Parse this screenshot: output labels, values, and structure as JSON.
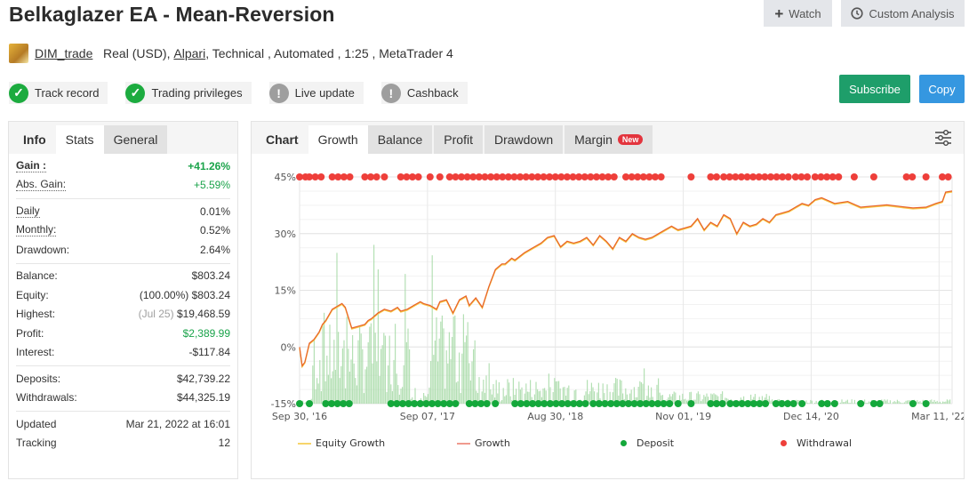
{
  "header": {
    "title": "Belkaglazer EA - Mean-Reversion",
    "watch_label": "Watch",
    "custom_analysis_label": "Custom Analysis"
  },
  "meta": {
    "author": "DIM_trade",
    "account_type": "Real (USD),",
    "broker": "Alpari",
    "rest": ", Technical , Automated , 1:25 , MetaTrader 4"
  },
  "badges": [
    {
      "label": "Track record",
      "status": "ok",
      "icon": "check-icon"
    },
    {
      "label": "Trading privileges",
      "status": "ok",
      "icon": "check-icon"
    },
    {
      "label": "Live update",
      "status": "warn",
      "icon": "exclamation-icon"
    },
    {
      "label": "Cashback",
      "status": "warn",
      "icon": "exclamation-icon"
    }
  ],
  "actions": {
    "subscribe_label": "Subscribe",
    "copy_label": "Copy"
  },
  "stats_panel": {
    "tabs": [
      "Info",
      "Stats",
      "General"
    ],
    "active_tab": "Stats",
    "groups": [
      [
        {
          "label": "Gain :",
          "value": "+41.26%"
        },
        {
          "label": "Abs. Gain:",
          "value": "+5.59%"
        }
      ],
      [
        {
          "label": "Daily",
          "value": "0.01%"
        },
        {
          "label": "Monthly:",
          "value": "0.52%"
        },
        {
          "label": "Drawdown:",
          "value": "2.64%"
        }
      ],
      [
        {
          "label": "Balance:",
          "value": "$803.24"
        },
        {
          "label": "Equity:",
          "prefix": "(100.00%)",
          "value": "$803.24"
        },
        {
          "label": "Highest:",
          "prefix": "(Jul 25)",
          "value": "$19,468.59"
        },
        {
          "label": "Profit:",
          "value": "$2,389.99"
        },
        {
          "label": "Interest:",
          "value": "-$117.84"
        }
      ],
      [
        {
          "label": "Deposits:",
          "value": "$42,739.22"
        },
        {
          "label": "Withdrawals:",
          "value": "$44,325.19"
        }
      ],
      [
        {
          "label": "Updated",
          "value": "Mar 21, 2022 at 16:01"
        },
        {
          "label": "Tracking",
          "value": "12"
        }
      ]
    ]
  },
  "chart_panel": {
    "tabs": [
      "Chart",
      "Growth",
      "Balance",
      "Profit",
      "Drawdown",
      "Margin"
    ],
    "active_tab": "Growth",
    "new_badge": "New"
  },
  "colors": {
    "growth": "#e8622a",
    "equity_growth": "#f7c948",
    "deposit": "#14a83b",
    "withdrawal": "#ee3f3a",
    "bars": "#a8dba8",
    "subscribe": "#1e9e6a",
    "copy": "#3597e0"
  },
  "chart_data": {
    "type": "line",
    "title": "",
    "xlabel": "",
    "ylabel": "",
    "ylim": [
      -15,
      45
    ],
    "y_ticks": [
      "-15%",
      "0%",
      "15%",
      "30%",
      "45%"
    ],
    "y_tick_values": [
      -15,
      0,
      15,
      30,
      45
    ],
    "x_ticks": [
      "Sep 30, '16",
      "Sep 07, '17",
      "Aug 30, '18",
      "Nov 01, '19",
      "Dec 14, '20",
      "Mar 11, '22"
    ],
    "x_tick_positions": [
      0,
      0.196,
      0.392,
      0.588,
      0.784,
      0.98
    ],
    "grid": true,
    "legend": [
      "Equity Growth",
      "Growth",
      "Deposit",
      "Withdrawal"
    ],
    "legend_position": "bottom",
    "series": [
      {
        "name": "Growth",
        "x": [
          0,
          0.004,
          0.008,
          0.015,
          0.022,
          0.03,
          0.035,
          0.04,
          0.05,
          0.06,
          0.065,
          0.07,
          0.08,
          0.09,
          0.1,
          0.105,
          0.11,
          0.12,
          0.13,
          0.14,
          0.15,
          0.155,
          0.165,
          0.175,
          0.185,
          0.19,
          0.2,
          0.21,
          0.215,
          0.225,
          0.235,
          0.245,
          0.255,
          0.26,
          0.27,
          0.28,
          0.29,
          0.3,
          0.31,
          0.315,
          0.325,
          0.33,
          0.345,
          0.36,
          0.37,
          0.38,
          0.39,
          0.4,
          0.41,
          0.42,
          0.43,
          0.44,
          0.45,
          0.46,
          0.47,
          0.48,
          0.49,
          0.5,
          0.51,
          0.52,
          0.53,
          0.54,
          0.55,
          0.56,
          0.57,
          0.58,
          0.59,
          0.6,
          0.61,
          0.62,
          0.63,
          0.64,
          0.65,
          0.66,
          0.67,
          0.68,
          0.69,
          0.7,
          0.71,
          0.72,
          0.73,
          0.74,
          0.75,
          0.76,
          0.77,
          0.78,
          0.79,
          0.8,
          0.82,
          0.84,
          0.86,
          0.88,
          0.9,
          0.92,
          0.94,
          0.96,
          0.975,
          0.985,
          0.99,
          1.0
        ],
        "values": [
          0,
          -5,
          -4,
          1,
          2,
          4,
          6,
          7,
          10,
          11,
          11.5,
          10.5,
          5,
          5.5,
          6,
          7,
          7.5,
          9,
          10,
          9.5,
          10.5,
          9.5,
          10,
          11,
          12,
          11.5,
          11,
          10,
          12,
          12.5,
          9,
          12.5,
          13.5,
          11,
          13,
          10.5,
          16,
          20.5,
          22,
          22,
          23.5,
          23,
          25,
          26.5,
          27.5,
          29,
          29.5,
          26.5,
          28,
          27.5,
          28,
          29,
          27,
          29.5,
          28,
          26,
          29,
          28,
          30,
          29,
          28.5,
          29,
          30,
          31,
          32,
          31,
          31.5,
          32,
          34,
          31,
          33,
          32,
          35,
          34,
          30,
          33,
          32,
          32.5,
          34,
          33,
          35,
          35.5,
          36,
          37,
          38,
          37.5,
          39,
          39.5,
          38,
          38.5,
          37,
          37.3,
          37.6,
          37.2,
          36.8,
          37,
          38,
          38.5,
          41,
          41.26
        ]
      },
      {
        "name": "Equity Growth",
        "note": "closely overlaps Growth"
      }
    ],
    "deposit_markers_y": -15,
    "withdrawal_markers_y": 45
  }
}
